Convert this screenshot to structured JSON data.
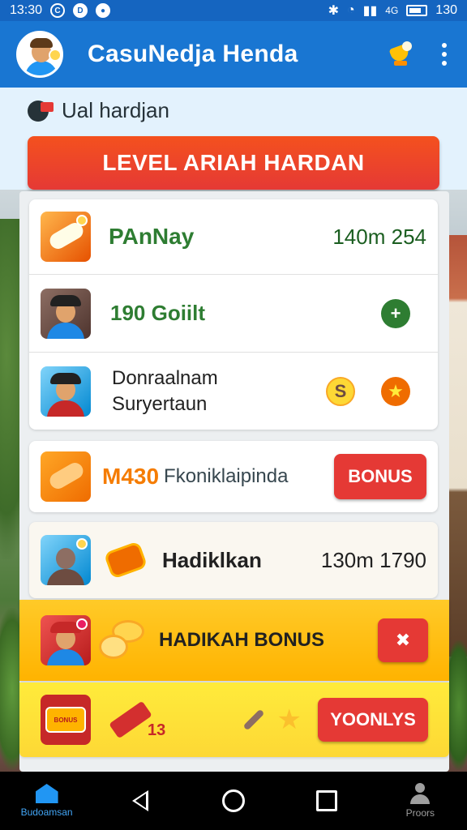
{
  "status_bar": {
    "time": "13:30",
    "network": "4G",
    "battery": "130"
  },
  "app_bar": {
    "title": "CasuNedja Henda"
  },
  "header": {
    "subtitle": "Ual hardjan",
    "level_banner": "LEVEL ARIAH HARDAN"
  },
  "list_card": {
    "items": [
      {
        "label": "PAnNay",
        "value": "140m 254"
      },
      {
        "label": "190 Goiilt"
      },
      {
        "label_line1": "Donraalnam",
        "label_line2": "Suryertaun"
      }
    ]
  },
  "bonus_card": {
    "code": "M430",
    "text": "Fkoniklaipinda",
    "button_label": "BONUS"
  },
  "hadiklan_row": {
    "label": "Hadiklkan",
    "value": "130m 1790"
  },
  "hadikah_row": {
    "label": "HADIKAH BONUS"
  },
  "yoonlys_row": {
    "number": "13",
    "button_label": "YOONLYS",
    "badge_text": "BONUS"
  },
  "nav_bar": {
    "home_label": "Budoamsan",
    "profile_label": "Proors"
  },
  "colors": {
    "primary": "#1976d2",
    "banner_red": "#e53935",
    "green": "#2e7d32",
    "gold": "#ffb300"
  }
}
